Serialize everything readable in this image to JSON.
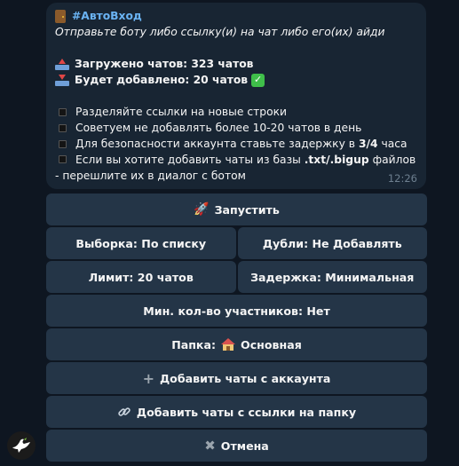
{
  "message": {
    "title": "#АвтоВход",
    "subtitle": "Отправьте боту либо ссылку(и) на чат либо его(их) айди",
    "loaded": "Загружено чатов: 323 чатов",
    "to_add": "Будет добавлено: 20 чатов",
    "tips": [
      "Разделяйте ссылки на новые строки",
      "Советуем не добавлять более 10-20 чатов в день"
    ],
    "tip3_a": "Для безопасности аккаунта ставьте задержку в ",
    "tip3_b": "3/4",
    "tip3_c": " часа",
    "tip4_a": "Если вы хотите добавить чаты из базы ",
    "tip4_b": ".txt/.bigup",
    "tip4_c": " файлов - перешлите их в диалог с ботом",
    "time": "12:26"
  },
  "keyboard": {
    "start": "Запустить",
    "selection": "Выборка: По списку",
    "duplicates": "Дубли: Не Добавлять",
    "limit": "Лимит: 20 чатов",
    "delay": "Задержка: Минимальная",
    "min_members": "Мин. кол-во участников: Нет",
    "folder_label": "Папка:",
    "folder_value": "Основная",
    "add_from_account": "Добавить чаты с аккаунта",
    "add_from_folder_link": "Добавить чаты с ссылки на папку",
    "cancel": "Отмена"
  },
  "icons": {
    "title": "door-icon",
    "loaded": "outbox-tray-icon",
    "to_add": "inbox-tray-icon",
    "check": "check-mark-icon",
    "start": "rocket-icon",
    "folder": "house-icon",
    "add": "plus-icon",
    "link": "link-icon",
    "cancel": "cross-icon",
    "avatar": "dove-icon"
  }
}
